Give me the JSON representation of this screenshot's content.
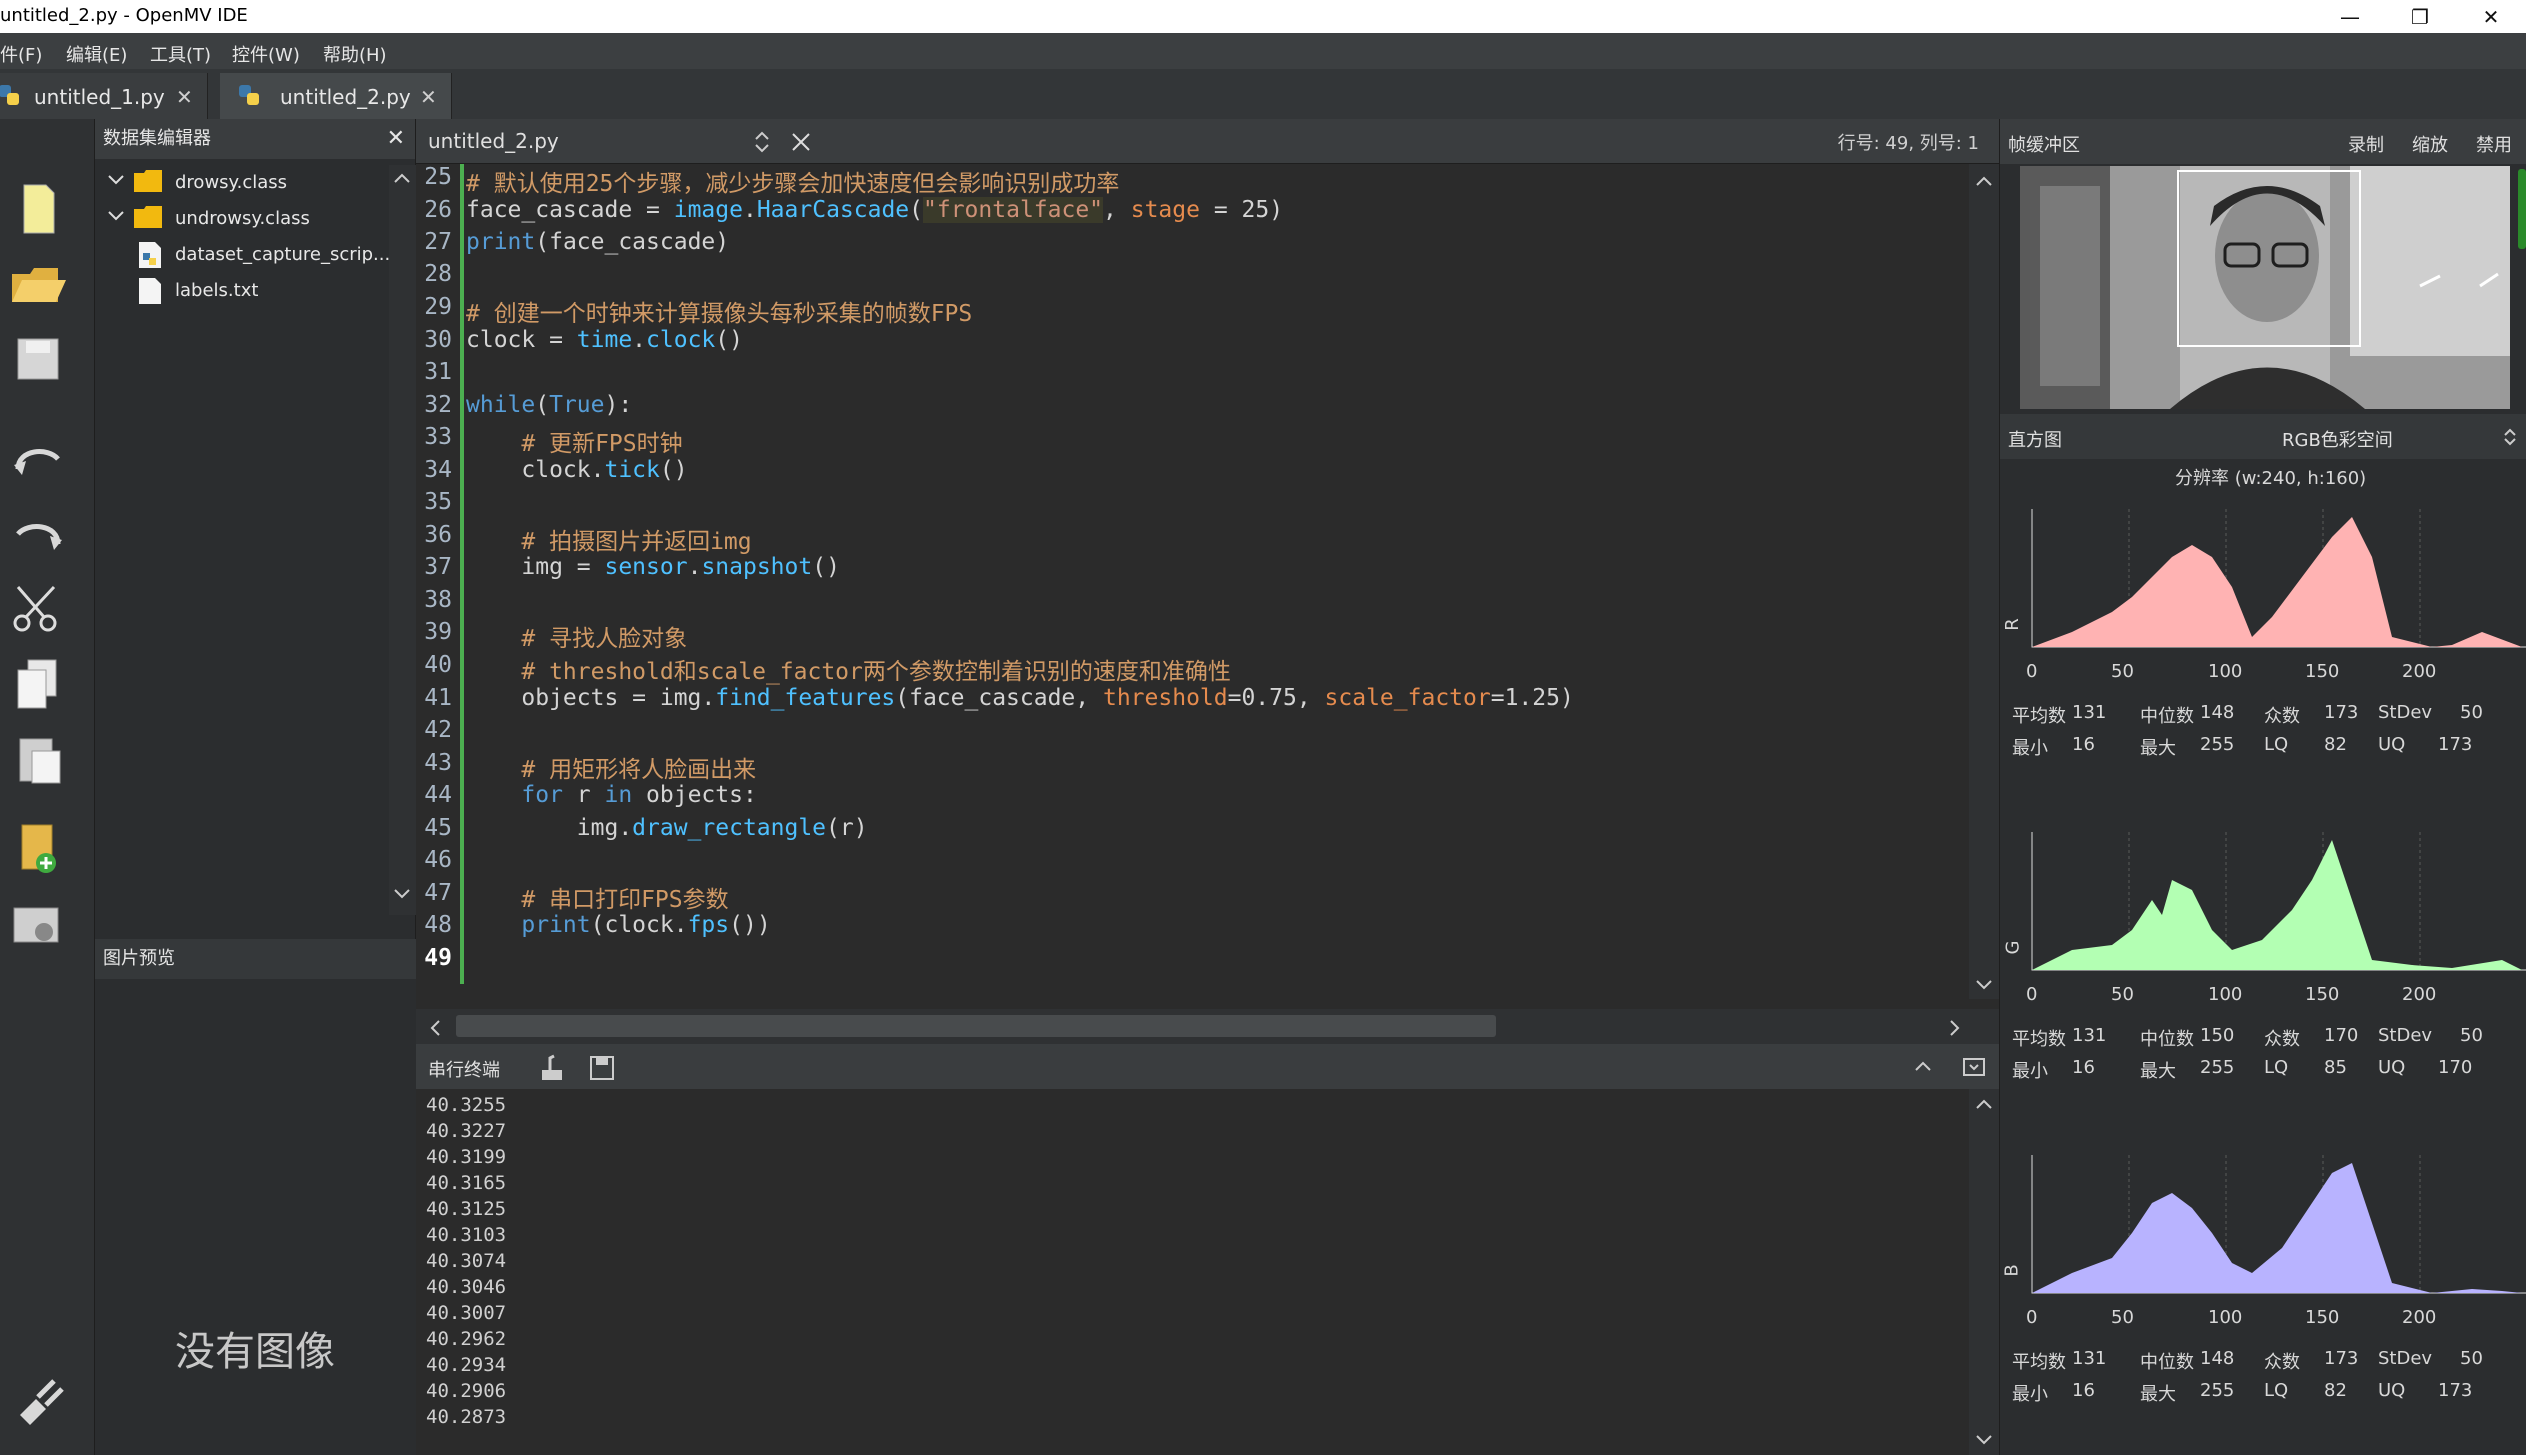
{
  "window": {
    "title": "untitled_2.py - OpenMV IDE",
    "min": "—",
    "max": "❐",
    "close": "✕"
  },
  "menu": [
    "件(F)",
    "编辑(E)",
    "工具(T)",
    "控件(W)",
    "帮助(H)"
  ],
  "file_tabs": [
    {
      "label": "untitled_1.py",
      "close": "✕"
    },
    {
      "label": "untitled_2.py",
      "close": "✕"
    }
  ],
  "dataset_editor": {
    "title": "数据集编辑器",
    "close": "✕",
    "items": [
      {
        "label": "drowsy.class",
        "type": "folder"
      },
      {
        "label": "undrowsy.class",
        "type": "folder"
      },
      {
        "label": "dataset_capture_scrip...",
        "type": "python"
      },
      {
        "label": "labels.txt",
        "type": "text"
      }
    ],
    "image_preview_title": "图片预览",
    "no_image": "没有图像"
  },
  "editor": {
    "filename": "untitled_2.py",
    "cursor_position": "行号: 49, 列号: 1",
    "line_numbers": [
      "25",
      "26",
      "27",
      "28",
      "29",
      "30",
      "31",
      "32",
      "33",
      "34",
      "35",
      "36",
      "37",
      "38",
      "39",
      "40",
      "41",
      "42",
      "43",
      "44",
      "45",
      "46",
      "47",
      "48",
      "49"
    ]
  },
  "serial_terminal": {
    "title": "串行终端",
    "lines": [
      "40.3255",
      "40.3227",
      "40.3199",
      "40.3165",
      "40.3125",
      "40.3103",
      "40.3074",
      "40.3046",
      "40.3007",
      "40.2962",
      "40.2934",
      "40.2906",
      "40.2873"
    ]
  },
  "frame_buffer": {
    "title": "帧缓冲区",
    "record": "录制",
    "zoom": "缩放",
    "disable": "禁用"
  },
  "histogram": {
    "title": "直方图",
    "colorspace": "RGB色彩空间",
    "resolution": "分辨率 (w:240, h:160)",
    "x_ticks": [
      "0",
      "50",
      "100",
      "150",
      "200"
    ],
    "channels": [
      {
        "name": "R",
        "color": "#ffb3b3",
        "mean_label": "平均数",
        "mean": "131",
        "median_label": "中位数",
        "median": "148",
        "mode_label": "众数",
        "mode": "173",
        "stdev_label": "StDev",
        "stdev": "50",
        "min_label": "最小",
        "min": "16",
        "max_label": "最大",
        "max": "255",
        "lq_label": "LQ",
        "lq": "82",
        "uq_label": "UQ",
        "uq": "173"
      },
      {
        "name": "G",
        "color": "#b3ffb3",
        "mean_label": "平均数",
        "mean": "131",
        "median_label": "中位数",
        "median": "150",
        "mode_label": "众数",
        "mode": "170",
        "stdev_label": "StDev",
        "stdev": "50",
        "min_label": "最小",
        "min": "16",
        "max_label": "最大",
        "max": "255",
        "lq_label": "LQ",
        "lq": "85",
        "uq_label": "UQ",
        "uq": "170"
      },
      {
        "name": "B",
        "color": "#b8b3ff",
        "mean_label": "平均数",
        "mean": "131",
        "median_label": "中位数",
        "median": "148",
        "mode_label": "众数",
        "mode": "173",
        "stdev_label": "StDev",
        "stdev": "50",
        "min_label": "最小",
        "min": "16",
        "max_label": "最大",
        "max": "255",
        "lq_label": "LQ",
        "lq": "82",
        "uq_label": "UQ",
        "uq": "173"
      }
    ]
  }
}
